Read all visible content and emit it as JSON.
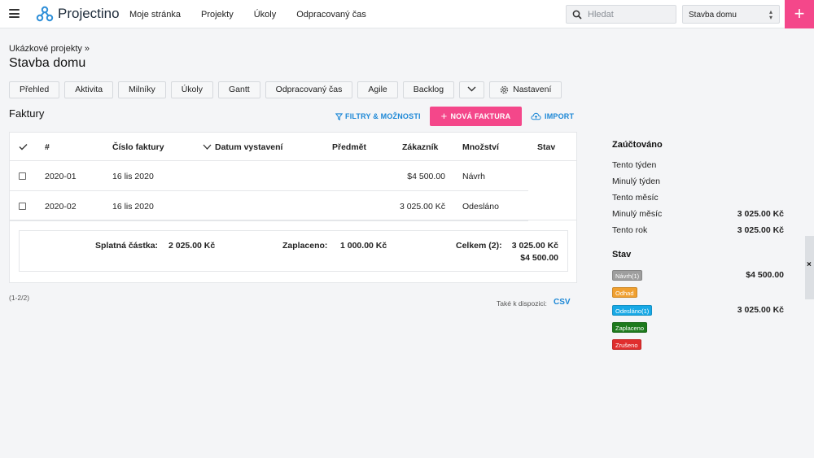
{
  "header": {
    "brand": "Projectino",
    "nav": [
      "Moje stránka",
      "Projekty",
      "Úkoly",
      "Odpracovaný čas"
    ],
    "search_placeholder": "Hledat",
    "project_select": "Stavba domu",
    "add_label": "+"
  },
  "page": {
    "breadcrumb": "Ukázkové projekty »",
    "title": "Stavba domu",
    "tabs": [
      "Přehled",
      "Aktivita",
      "Milníky",
      "Úkoly",
      "Gantt",
      "Odpracovaný čas",
      "Agile",
      "Backlog"
    ],
    "settings_tab": "Nastavení"
  },
  "invoices": {
    "section_title": "Faktury",
    "filters_label": "FILTRY & MOŽNOSTI",
    "new_label": "NOVÁ FAKTURA",
    "import_label": "IMPORT",
    "columns": [
      "#",
      "Číslo faktury",
      "Datum vystavení",
      "Předmět",
      "Zákazník",
      "Množství",
      "Stav"
    ],
    "rows": [
      {
        "number": "2020-01",
        "date": "16 lis 2020",
        "amount": "$4 500.00",
        "status": "Návrh"
      },
      {
        "number": "2020-02",
        "date": "16 lis 2020",
        "amount": "3 025.00 Kč",
        "status": "Odesláno"
      }
    ],
    "summary": {
      "due_label": "Splatná částka:",
      "due_value": "2 025.00 Kč",
      "paid_label": "Zaplaceno:",
      "paid_value": "1 000.00 Kč",
      "total_label": "Celkem (2):",
      "total_value_1": "3 025.00 Kč",
      "total_value_2": "$4 500.00"
    },
    "pager": "(1-2/2)",
    "export_label": "Také k dispozici:",
    "csv_label": "CSV"
  },
  "sidebar": {
    "billed_title": "Zaúčtováno",
    "billed": [
      {
        "label": "Tento týden",
        "value": ""
      },
      {
        "label": "Minulý týden",
        "value": ""
      },
      {
        "label": "Tento měsíc",
        "value": ""
      },
      {
        "label": "Minulý měsíc",
        "value": "3 025.00 Kč"
      },
      {
        "label": "Tento rok",
        "value": "3 025.00 Kč"
      }
    ],
    "status_title": "Stav",
    "statuses": [
      {
        "label": "Návrh(1)",
        "value": "$4 500.00",
        "color": "#9e9e9e"
      },
      {
        "label": "Odhad",
        "value": "",
        "color": "#f0a030"
      },
      {
        "label": "Odesláno(1)",
        "value": "3 025.00 Kč",
        "color": "#17a9e6"
      },
      {
        "label": "Zaplaceno",
        "value": "",
        "color": "#1d7a1d"
      },
      {
        "label": "Zrušeno",
        "value": "",
        "color": "#e02d2d"
      }
    ],
    "close_label": "×"
  },
  "colors": {
    "accent": "#f4478a",
    "link": "#1b87d6"
  }
}
